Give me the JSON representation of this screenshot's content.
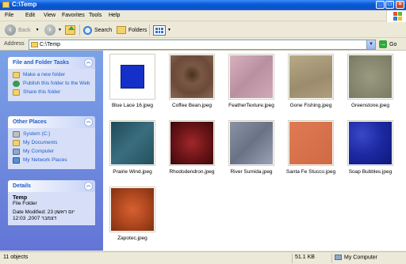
{
  "window": {
    "title": "C:\\Temp"
  },
  "menu": [
    "File",
    "Edit",
    "View",
    "Favorites",
    "Tools",
    "Help"
  ],
  "toolbar": {
    "back_label": "Back",
    "search_label": "Search",
    "folders_label": "Folders"
  },
  "address": {
    "label": "Address",
    "path": "C:\\Temp",
    "go_label": "Go"
  },
  "tasks": {
    "title": "File and Folder Tasks",
    "items": [
      {
        "label": "Make a new folder",
        "icon": "new-folder-icon"
      },
      {
        "label": "Publish this folder to the Web",
        "icon": "globe-icon"
      },
      {
        "label": "Share this folder",
        "icon": "share-icon"
      }
    ]
  },
  "other_places": {
    "title": "Other Places",
    "items": [
      {
        "label": "System (C:)",
        "icon": "drive-icon"
      },
      {
        "label": "My Documents",
        "icon": "documents-icon"
      },
      {
        "label": "My Computer",
        "icon": "computer-icon"
      },
      {
        "label": "My Network Places",
        "icon": "network-icon"
      }
    ]
  },
  "details": {
    "title": "Details",
    "name": "Temp",
    "type": "File Folder",
    "modified_line1": "Date Modified: 23 יום ראשון",
    "modified_line2": "דצמבר 2007, 12:03"
  },
  "files": [
    {
      "name": "Blue Lace 16.jpeg",
      "color": "#1530c8"
    },
    {
      "name": "Coffee Bean.jpeg",
      "color": "#6b4a3a"
    },
    {
      "name": "FeatherTexture.jpeg",
      "color": "#c8a0b0"
    },
    {
      "name": "Gone Fishing.jpeg",
      "color": "#a89a7a"
    },
    {
      "name": "Greenstone.jpeg",
      "color": "#8a8a72"
    },
    {
      "name": "Prairie Wind.jpeg",
      "color": "#2a5a6a"
    },
    {
      "name": "Rhododendron.jpeg",
      "color": "#6a1418"
    },
    {
      "name": "River Sumida.jpeg",
      "color": "#7a8296"
    },
    {
      "name": "Santa Fe Stucco.jpeg",
      "color": "#d8704a"
    },
    {
      "name": "Soap Bubbles.jpeg",
      "color": "#1c28a0"
    },
    {
      "name": "Zapotec.jpeg",
      "color": "#b04820"
    }
  ],
  "status": {
    "count": "11 objects",
    "size": "51.1 KB",
    "location": "My Computer"
  }
}
